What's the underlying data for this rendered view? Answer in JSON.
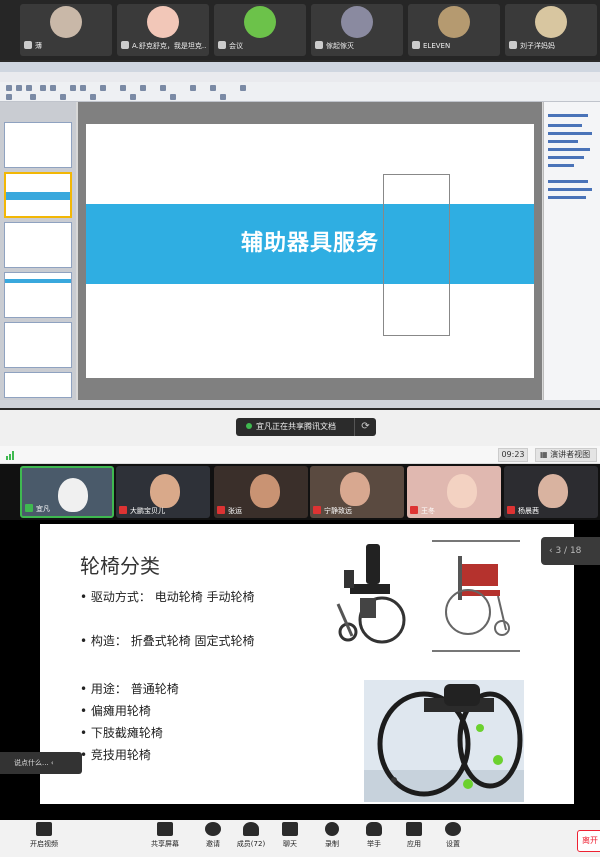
{
  "top_meeting": {
    "participants": [
      {
        "name": "薄",
        "avatar": "avatar-photo"
      },
      {
        "name": "A.舒克舒克，我是坦克...",
        "avatar": "avatar-cartoon-girl"
      },
      {
        "name": "会议",
        "avatar": "avatar-frog"
      },
      {
        "name": "傢起傢灭",
        "avatar": "avatar-figure"
      },
      {
        "name": "ELEVEN",
        "avatar": "avatar-drawing"
      },
      {
        "name": "刘子洋妈妈",
        "avatar": "avatar-animal"
      }
    ],
    "wps_slide_title": "辅助器具服务"
  },
  "share_banner": {
    "text": "宜凡正在共享腾讯文档",
    "refresh_icon": "refresh-icon"
  },
  "status_row": {
    "time": "09:23",
    "view_button": "演讲者视图"
  },
  "video_strip": [
    {
      "name": "宜凡"
    },
    {
      "name": "大鹏宝贝儿"
    },
    {
      "name": "张运"
    },
    {
      "name": "宁静致远"
    },
    {
      "name": "王冬"
    },
    {
      "name": "杨晨茜"
    }
  ],
  "slide": {
    "title": "轮椅分类",
    "lines": [
      "• 驱动方式：  电动轮椅    手动轮椅",
      "• 构造：  折叠式轮椅    固定式轮椅",
      "• 用途：   普通轮椅",
      "•                 偏瘫用轮椅",
      "•                 下肢截瘫轮椅",
      "•                  竞技用轮椅"
    ],
    "page": "3 / 18"
  },
  "comment_chip": "说点什么...",
  "toolbar": [
    {
      "label": "开启视频",
      "icon": "camera-off-icon"
    },
    {
      "label": "共享屏幕",
      "icon": "share-screen-icon"
    },
    {
      "label": "邀请",
      "icon": "invite-icon"
    },
    {
      "label": "成员(72)",
      "icon": "members-icon"
    },
    {
      "label": "聊天",
      "icon": "chat-icon"
    },
    {
      "label": "录制",
      "icon": "record-icon"
    },
    {
      "label": "举手",
      "icon": "hand-icon"
    },
    {
      "label": "应用",
      "icon": "apps-icon"
    },
    {
      "label": "设置",
      "icon": "settings-icon"
    }
  ],
  "leave_label": "离开",
  "colors": {
    "slide_band": "#2faee2",
    "accent_red": "#e23333",
    "green": "#3fb950"
  }
}
